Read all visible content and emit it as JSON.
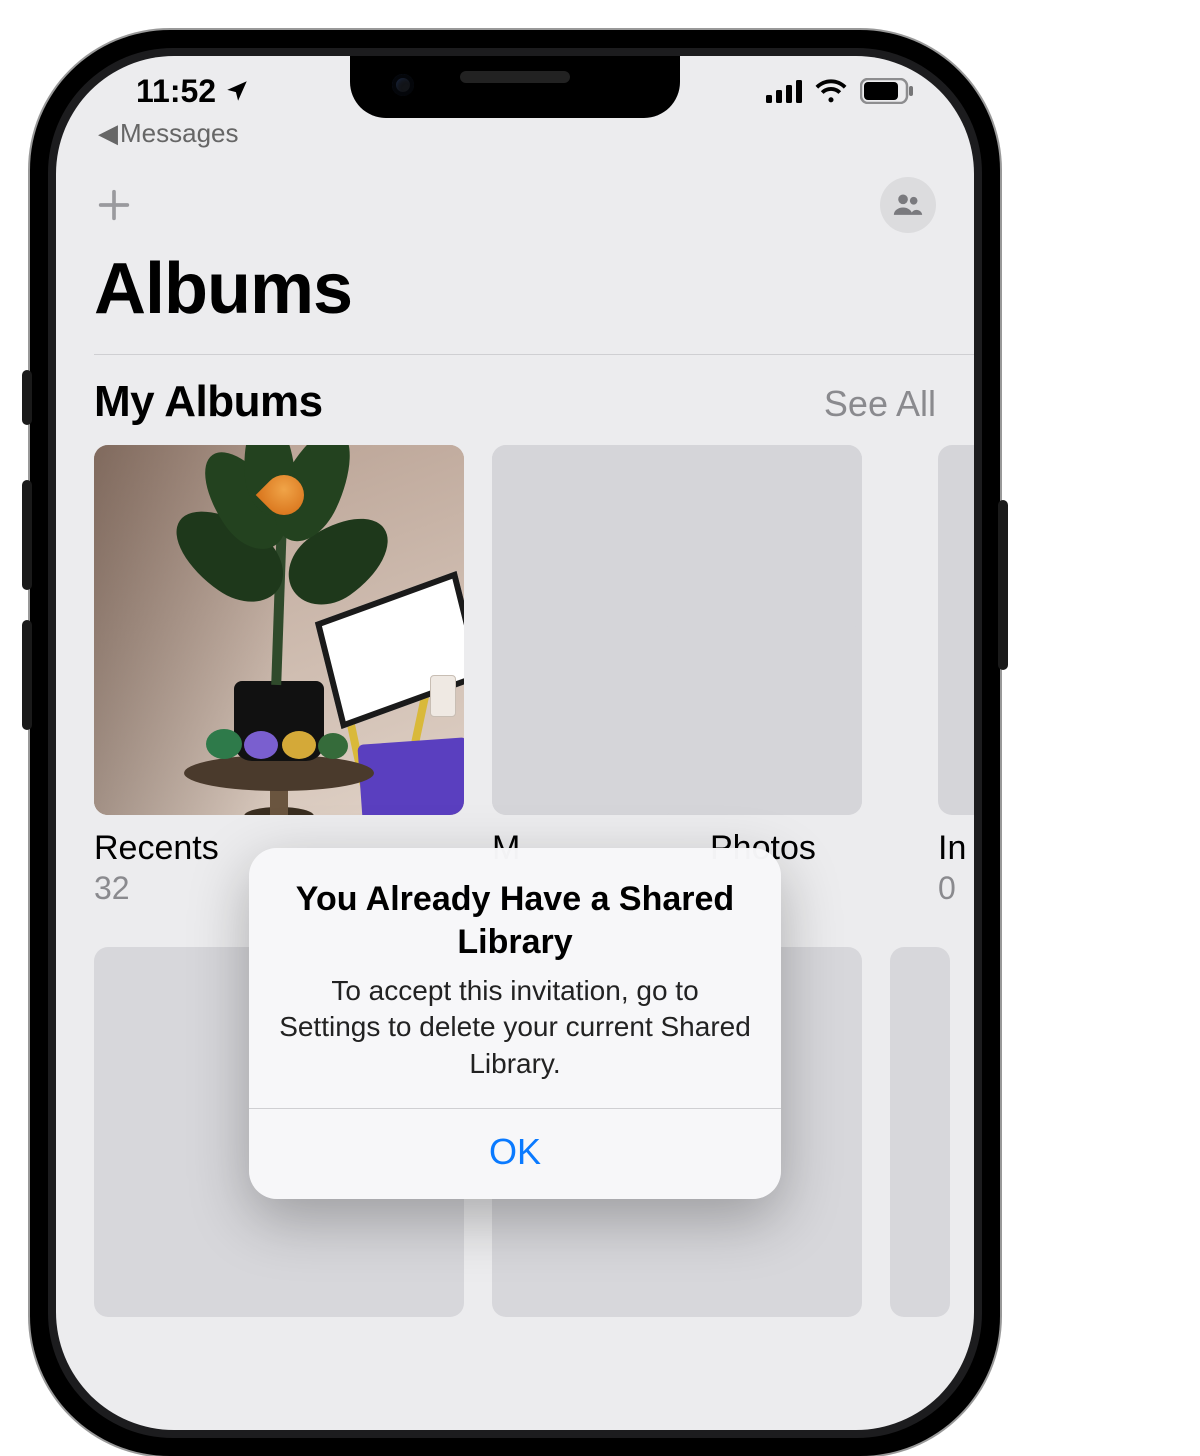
{
  "status": {
    "time": "11:52",
    "breadcrumb_label": "Messages"
  },
  "page": {
    "title": "Albums"
  },
  "section": {
    "title": "My Albums",
    "see_all": "See All"
  },
  "albums": [
    {
      "name": "Recents",
      "count": "32"
    },
    {
      "name": "M",
      "count": ""
    },
    {
      "name": "Photos",
      "count": ""
    },
    {
      "name": "In",
      "count": "0"
    }
  ],
  "alert": {
    "title": "You Already Have a Shared Library",
    "message": "To accept this invitation, go to Settings to delete your current Shared Library.",
    "ok": "OK"
  }
}
